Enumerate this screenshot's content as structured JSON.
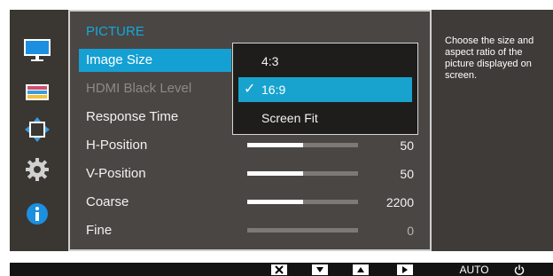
{
  "menu": {
    "title": "PICTURE",
    "items": [
      {
        "label": "Image Size"
      },
      {
        "label": "HDMI Black Level"
      },
      {
        "label": "Response Time"
      },
      {
        "label": "H-Position",
        "value": "50",
        "level": 0.5
      },
      {
        "label": "V-Position",
        "value": "50",
        "level": 0.5
      },
      {
        "label": "Coarse",
        "value": "2200",
        "level": 0.5
      },
      {
        "label": "Fine",
        "value": "0",
        "level": 0.0
      }
    ]
  },
  "dropdown": {
    "options": [
      "4:3",
      "16:9",
      "Screen Fit"
    ],
    "selected": "16:9",
    "check_glyph": "✓"
  },
  "help_text": "Choose the size and aspect ratio of the picture displayed on screen.",
  "bottom_bar": {
    "auto_label": "AUTO",
    "icons": [
      "close-icon",
      "down-arrow-icon",
      "up-arrow-icon",
      "enter-icon",
      "power-icon"
    ]
  },
  "left_icons": [
    "picture-monitor-icon",
    "color-icon",
    "size-position-icon",
    "setup-gear-icon",
    "information-icon"
  ],
  "colors": {
    "accent": "#15a0d4",
    "title": "#12a8de",
    "panel": "#4a4643",
    "background": "#3e3b38"
  }
}
